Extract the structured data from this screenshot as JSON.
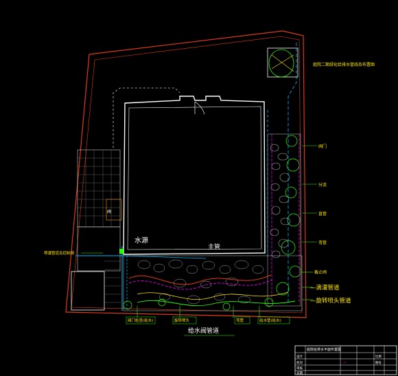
{
  "drawing": {
    "note_top_right": "庭院二期绿化给排水管线及布置图",
    "labels": {
      "water_source": "水源",
      "main_pipe": "主管",
      "left_label": "喷灌管道及控制阀",
      "right_1": "阀门",
      "right_2": "分流",
      "right_3": "直管",
      "right_4": "弯管",
      "right_5": "截止阀",
      "right_6": "—滴灌管道",
      "right_7": "—旋转喷头管道",
      "bottom_1": "阀门检查(给水)",
      "bottom_2": "旋转喷头",
      "bottom_3": "弯管",
      "bottom_4": "给水管(给水)",
      "bottom_title": "给水阀管道",
      "small_label": "阀"
    },
    "title_block": {
      "drawing_name": "庭院给排水平面布置图",
      "rows": [
        "设计",
        "校对",
        "审核",
        "日期"
      ],
      "scale": "比例",
      "sheet": "图号",
      "misc": "—"
    },
    "colors": {
      "boundary": "#e03a1a",
      "building": "#ffffff",
      "pipe_main": "#00b6ff",
      "pipe_drip": "#ff00ff",
      "planting": "#29ff00",
      "paving": "#c9c9c9",
      "path": "#ffe600",
      "stone": "#aaaaaa"
    }
  }
}
